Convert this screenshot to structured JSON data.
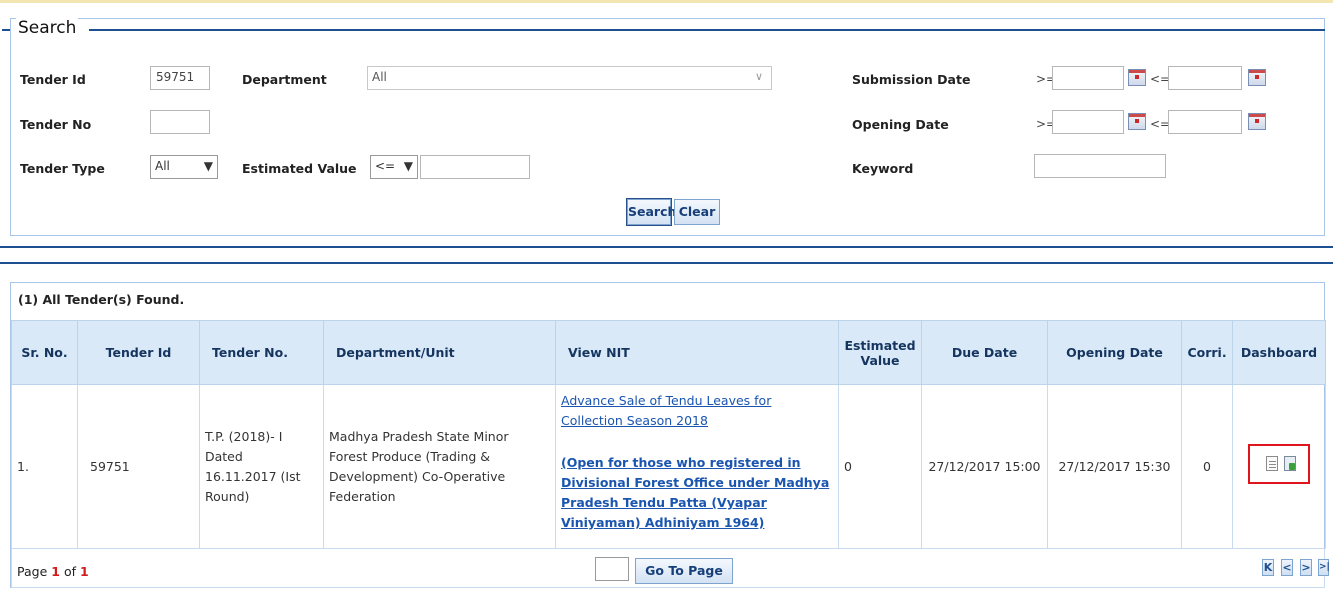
{
  "search": {
    "legend": "Search",
    "tender_id_label": "Tender Id",
    "tender_id_value": "59751",
    "department_label": "Department",
    "department_value": "All",
    "submission_date_label": "Submission Date",
    "opening_date_label": "Opening Date",
    "gte_label": ">=",
    "lte_label": "<=",
    "tender_no_label": "Tender No",
    "tender_no_value": "",
    "tender_type_label": "Tender Type",
    "tender_type_value": "All",
    "estimated_value_label": "Estimated Value",
    "estimated_operator_value": "<=",
    "estimated_value": "",
    "keyword_label": "Keyword",
    "keyword_value": "",
    "search_button": "Search",
    "clear_button": "Clear"
  },
  "results": {
    "found_text": "(1) All Tender(s) Found.",
    "columns": [
      "Sr. No.",
      "Tender Id",
      "Tender No.",
      "Department/Unit",
      "View NIT",
      "Estimated Value",
      "Due Date",
      "Opening Date",
      "Corri.",
      "Dashboard"
    ],
    "rows": [
      {
        "sr_no": "1.",
        "tender_id": "59751",
        "tender_no": "T.P. (2018)- I Dated 16.11.2017 (Ist Round)",
        "department": "Madhya Pradesh State Minor Forest Produce (Trading & Development) Co-Operative Federation",
        "nit_link": "Advance Sale of Tendu Leaves for Collection Season 2018",
        "nit_note": "(Open for those who registered in Divisional Forest Office under Madhya Pradesh Tendu Patta (Vyapar Viniyaman) Adhiniyam 1964)",
        "estimated_value": "0",
        "due_date": "27/12/2017 15:00",
        "opening_date": "27/12/2017 15:30",
        "corri": "0"
      }
    ]
  },
  "pager": {
    "page_prefix": "Page",
    "current_page": "1",
    "of_text": "of",
    "total_pages": "1",
    "goto_value": "",
    "goto_button": "Go To Page",
    "first_glyph": "K",
    "prev_glyph": "<",
    "next_glyph": ">",
    "last_glyph": ">|"
  },
  "icons": {
    "calendar": "calendar-icon",
    "document": "document-icon",
    "download": "download-icon",
    "first_page": "first-page-icon",
    "prev_page": "prev-page-icon",
    "next_page": "next-page-icon",
    "last_page": "last-page-icon"
  },
  "colors": {
    "header_bg": "#d9e9f8",
    "link": "#1a55b0",
    "highlight": "#e0141b",
    "rule": "#1d4f91"
  }
}
